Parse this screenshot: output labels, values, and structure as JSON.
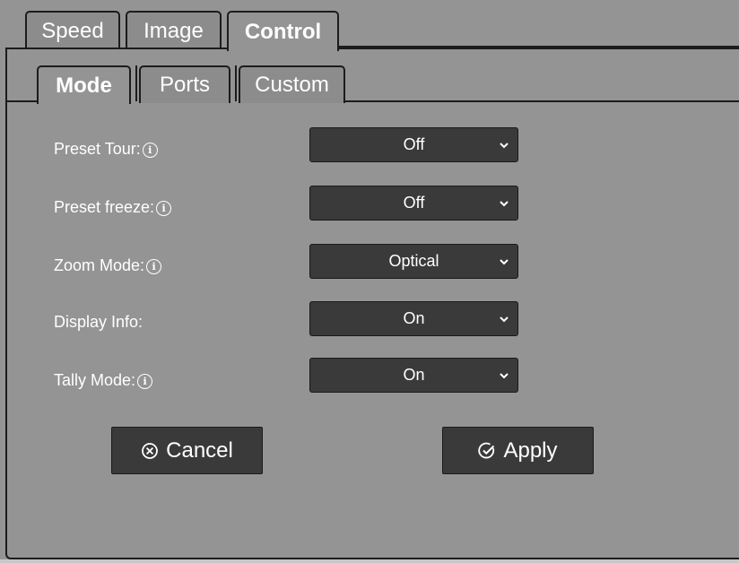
{
  "main_tabs": [
    {
      "label": "Speed"
    },
    {
      "label": "Image"
    },
    {
      "label": "Control",
      "active": true
    }
  ],
  "sub_tabs": [
    {
      "label": "Mode",
      "active": true
    },
    {
      "label": "Ports"
    },
    {
      "label": "Custom"
    }
  ],
  "settings": [
    {
      "label": "Preset Tour:",
      "info_icon": true,
      "value": "Off"
    },
    {
      "label": "Preset freeze:",
      "info_icon": true,
      "value": "Off"
    },
    {
      "label": "Zoom Mode:",
      "info_icon": true,
      "value": "Optical"
    },
    {
      "label": "Display Info:",
      "info_icon": false,
      "value": "On"
    },
    {
      "label": "Tally Mode:",
      "info_icon": true,
      "value": "On"
    }
  ],
  "buttons": {
    "cancel_label": "Cancel",
    "cancel_icon": "circle-x-icon",
    "apply_label": "Apply",
    "apply_icon": "circle-check-icon"
  },
  "icons": {
    "info": "i"
  },
  "colors": {
    "background": "#949494",
    "control_bg": "#3a3a3a",
    "border": "#1c1c1c",
    "text": "#ffffff"
  }
}
